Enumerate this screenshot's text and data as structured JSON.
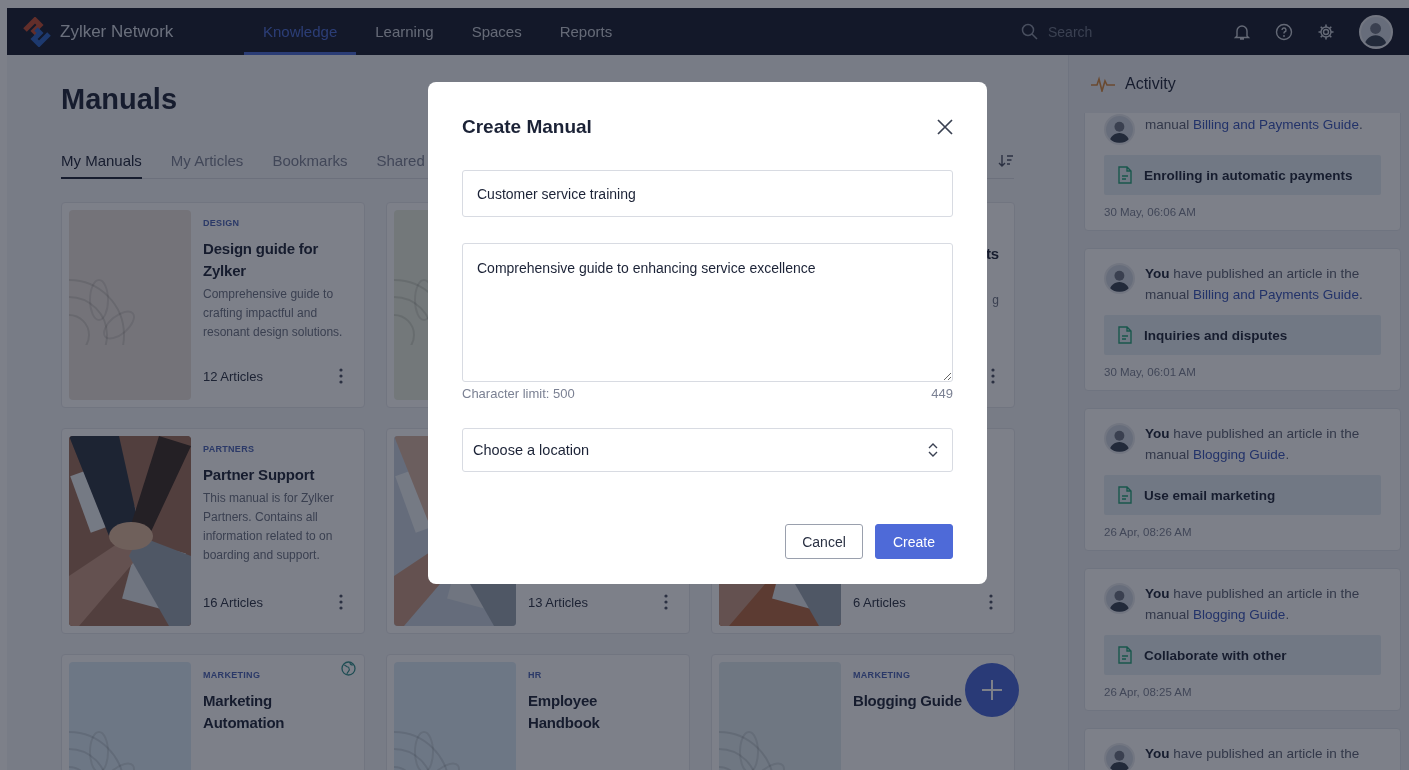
{
  "header": {
    "brand": "Zylker Network",
    "nav": [
      {
        "label": "Knowledge",
        "selected": true
      },
      {
        "label": "Learning",
        "selected": false
      },
      {
        "label": "Spaces",
        "selected": false
      },
      {
        "label": "Reports",
        "selected": false
      }
    ],
    "search": {
      "placeholder": "Search"
    }
  },
  "page": {
    "title": "Manuals",
    "tabs": [
      {
        "label": "My Manuals",
        "selected": true
      },
      {
        "label": "My Articles",
        "selected": false
      },
      {
        "label": "Bookmarks",
        "selected": false
      },
      {
        "label": "Shared",
        "selected": false
      }
    ]
  },
  "cards": [
    {
      "kind": "full",
      "category": "DESIGN",
      "title": "Design guide for Zylker",
      "description": "Comprehensive guide to crafting impactful and resonant design solutions.",
      "count": "12 Articles",
      "thumb": {
        "kind": "pattern"
      },
      "public": false
    },
    {
      "kind": "hidden",
      "thumb": {
        "kind": "pattern"
      },
      "public": false
    },
    {
      "kind": "clipped",
      "title": "ts",
      "description": "g",
      "public": false
    },
    {
      "kind": "full",
      "category": "PARTNERS",
      "title": "Partner Support",
      "description": "This manual is for Zylker Partners. Contains all information related to on boarding and support.",
      "count": "16 Articles",
      "public": false
    },
    {
      "kind": "full",
      "count": "13 Articles",
      "public": false
    },
    {
      "kind": "full",
      "count": "6 Articles",
      "public": false
    },
    {
      "kind": "full",
      "category": "MARKETING",
      "title": "Marketing Automation",
      "thumb": {
        "kind": "pattern"
      },
      "public": true
    },
    {
      "kind": "full",
      "category": "HR",
      "title": "Employee Handbook",
      "thumb": {
        "kind": "pattern"
      },
      "public": false
    },
    {
      "kind": "full",
      "category": "MARKETING",
      "title": "Blogging Guide",
      "thumb": {
        "kind": "pattern"
      },
      "public": false
    }
  ],
  "activity": {
    "title": "Activity",
    "items": [
      {
        "text": "manual",
        "link": "Billing and Payments Guide",
        "end": ".",
        "article": "Enrolling in automatic payments",
        "time": "30 May, 06:06 AM"
      },
      {
        "text": "**You** have published an article in the manual",
        "link": "Billing and Payments Guide",
        "end": ".",
        "article": "Inquiries and disputes",
        "time": "30 May, 06:01 AM"
      },
      {
        "text": "**You** have published an article in the manual",
        "link": "Blogging Guide",
        "end": ".",
        "article": "Use email marketing",
        "time": "26 Apr, 08:26 AM"
      },
      {
        "text": "**You** have published an article in the manual",
        "link": "Blogging Guide",
        "end": ".",
        "article": "Collaborate with other",
        "time": "26 Apr, 08:25 AM"
      },
      {
        "text": "**You** have published an article in the"
      }
    ]
  },
  "dialog": {
    "title": "Create Manual",
    "name": {
      "value": "Customer service training"
    },
    "description": {
      "value": "Comprehensive guide to enhancing service excellence"
    },
    "limit": "Character limit: 500",
    "remaining": "449",
    "location": {
      "placeholder": "Choose a location"
    },
    "buttons": [
      {
        "kind": "secondary",
        "label": "Cancel"
      },
      {
        "kind": "primary",
        "label": "Create"
      }
    ]
  }
}
